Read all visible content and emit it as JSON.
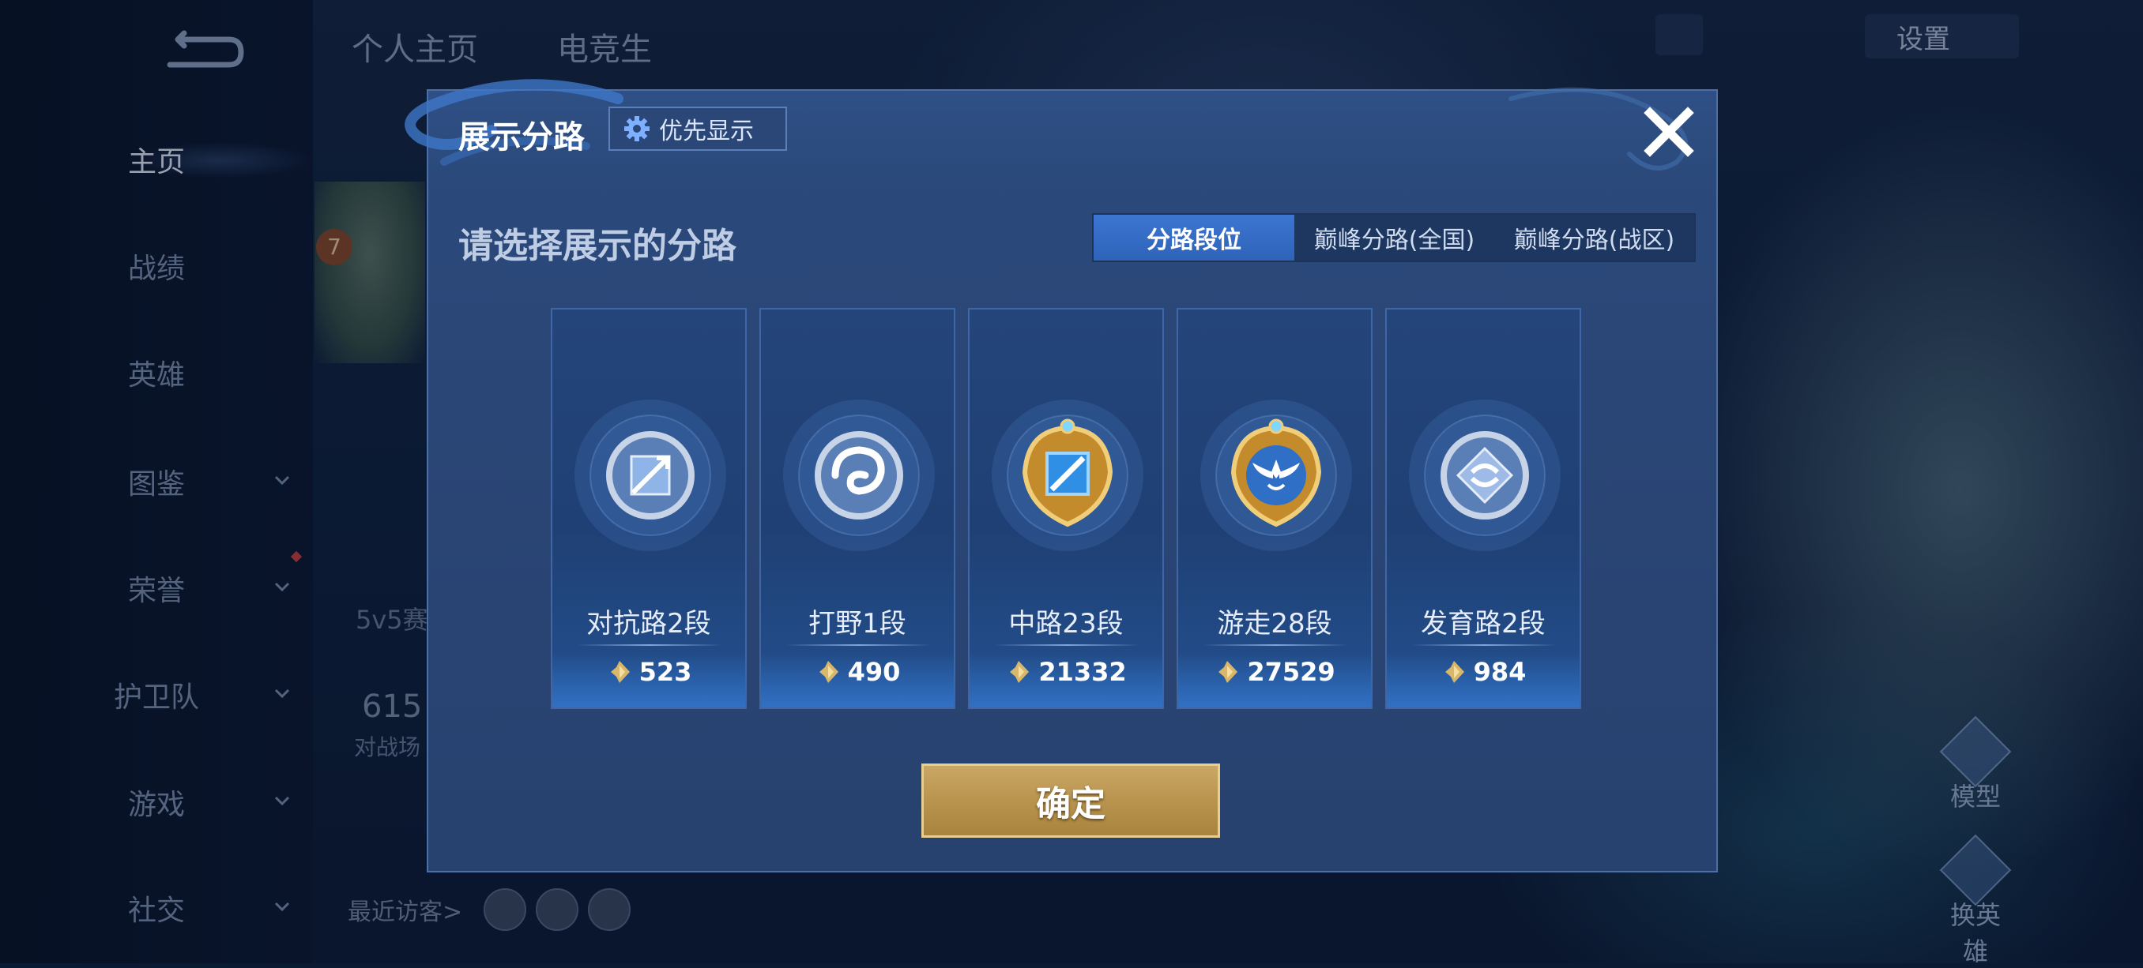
{
  "background": {
    "nav": {
      "items": [
        {
          "label": "主页",
          "active": true
        },
        {
          "label": "战绩"
        },
        {
          "label": "英雄"
        },
        {
          "label": "图鉴",
          "has_chevron": true
        },
        {
          "label": "荣誉",
          "has_chevron": true
        },
        {
          "label": "护卫队",
          "has_chevron": true
        },
        {
          "label": "游戏",
          "has_chevron": true
        },
        {
          "label": "社交",
          "has_chevron": true
        }
      ]
    },
    "top_tabs": [
      "个人主页",
      "电竞生"
    ],
    "settings_label": "设置",
    "level_badge": "7",
    "mode_text": "5v5赛",
    "stats_number": "615",
    "stats_label": "对战场",
    "recent_visitors": "最近访客>",
    "side_buttons": [
      "模型",
      "换英雄"
    ]
  },
  "modal": {
    "title": "展示分路",
    "priority_button": "优先显示",
    "subtitle": "请选择展示的分路",
    "tabs": [
      {
        "label": "分路段位",
        "active": true
      },
      {
        "label": "巅峰分路(全国)"
      },
      {
        "label": "巅峰分路(战区)"
      }
    ],
    "cards": [
      {
        "rank": "对抗路2段",
        "score": "523",
        "medal": "silver-sword-medal-icon",
        "tier": "silver"
      },
      {
        "rank": "打野1段",
        "score": "490",
        "medal": "silver-dragon-medal-icon",
        "tier": "silver"
      },
      {
        "rank": "中路23段",
        "score": "21332",
        "medal": "gold-wand-medal-icon",
        "tier": "gold"
      },
      {
        "rank": "游走28段",
        "score": "27529",
        "medal": "gold-wings-medal-icon",
        "tier": "gold"
      },
      {
        "rank": "发育路2段",
        "score": "984",
        "medal": "silver-arrow-medal-icon",
        "tier": "silver"
      }
    ],
    "confirm_button": "确定"
  },
  "colors": {
    "modal_bg": "#2a4676",
    "tab_active": "#3a73cf",
    "confirm_gold": "#b8944f",
    "gold_medal": "#d9a640",
    "silver_medal": "#aab9d0"
  }
}
